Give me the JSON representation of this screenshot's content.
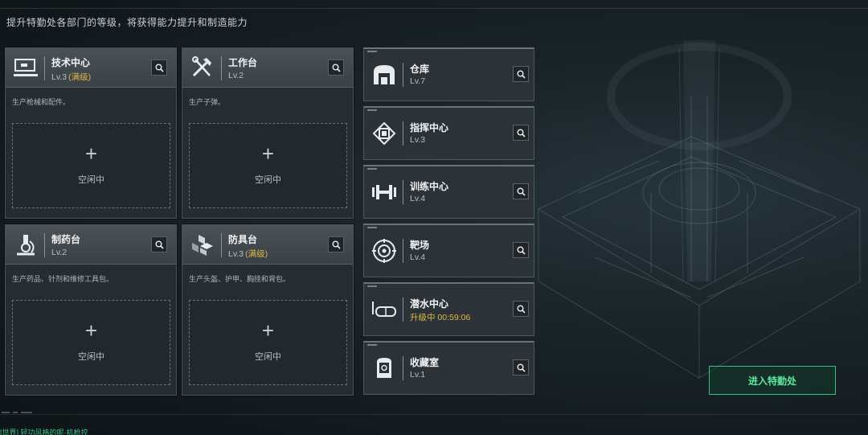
{
  "hint": "提升特勤处各部门的等级，将获得能力提升和制造能力",
  "cards": [
    {
      "title": "技术中心",
      "level": "Lv.3",
      "maxed": "(满级)",
      "desc": "生产枪械和配件。",
      "slot_label": "空闲中",
      "icon": "workstation-icon"
    },
    {
      "title": "工作台",
      "level": "Lv.2",
      "maxed": "",
      "desc": "生产子弹。",
      "slot_label": "空闲中",
      "icon": "tools-icon"
    },
    {
      "title": "制药台",
      "level": "Lv.2",
      "maxed": "",
      "desc": "生产药品、针剂和维修工具包。",
      "slot_label": "空闲中",
      "icon": "microscope-icon"
    },
    {
      "title": "防具台",
      "level": "Lv.3",
      "maxed": "(满级)",
      "desc": "生产头盔、护甲、胸挂和背包。",
      "slot_label": "空闲中",
      "icon": "armor-cubes-icon"
    }
  ],
  "side_cards": [
    {
      "title": "仓库",
      "level": "Lv.7",
      "upgrading": false,
      "icon": "warehouse-icon"
    },
    {
      "title": "指挥中心",
      "level": "Lv.3",
      "upgrading": false,
      "icon": "chip-icon"
    },
    {
      "title": "训练中心",
      "level": "Lv.4",
      "upgrading": false,
      "icon": "dumbbell-icon"
    },
    {
      "title": "靶场",
      "level": "Lv.4",
      "upgrading": false,
      "icon": "target-icon"
    },
    {
      "title": "潜水中心",
      "level": "升级中 00:59:06",
      "upgrading": true,
      "icon": "diving-mask-icon"
    },
    {
      "title": "收藏室",
      "level": "Lv.1",
      "upgrading": false,
      "icon": "display-case-icon"
    }
  ],
  "enter_button": "进入特勤处",
  "footer_text": "[世界] 轻功风格的呢·机枪控",
  "colors": {
    "accent_green": "#35c27a",
    "max_gold": "#e0b546",
    "panel": "#262d32"
  }
}
